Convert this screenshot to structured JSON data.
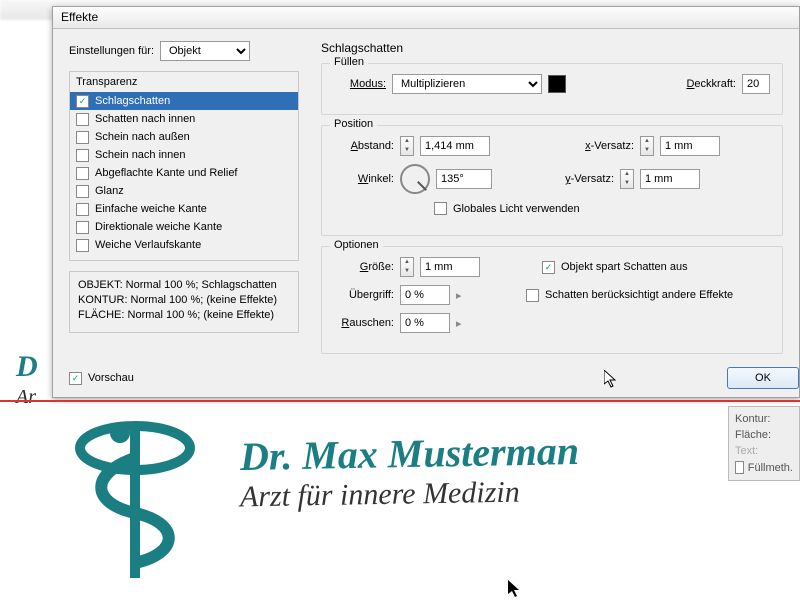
{
  "dialog": {
    "title": "Effekte",
    "settings_label": "Einstellungen für:",
    "settings_value": "Objekt",
    "transparency_group": "Transparenz",
    "effects": [
      {
        "label": "Schlagschatten",
        "checked": true,
        "selected": true
      },
      {
        "label": "Schatten nach innen",
        "checked": false
      },
      {
        "label": "Schein nach außen",
        "checked": false
      },
      {
        "label": "Schein nach innen",
        "checked": false
      },
      {
        "label": "Abgeflachte Kante und Relief",
        "checked": false
      },
      {
        "label": "Glanz",
        "checked": false
      },
      {
        "label": "Einfache weiche Kante",
        "checked": false
      },
      {
        "label": "Direktionale weiche Kante",
        "checked": false
      },
      {
        "label": "Weiche Verlaufskante",
        "checked": false
      }
    ],
    "status": {
      "l1": "OBJEKT: Normal 100 %; Schlagschatten",
      "l2": "KONTUR: Normal 100 %; (keine Effekte)",
      "l3": "FLÄCHE: Normal 100 %; (keine Effekte)"
    },
    "preview_label": "Vorschau",
    "ok_label": "OK"
  },
  "panel": {
    "title": "Schlagschatten",
    "fill": {
      "group": "Füllen",
      "mode_label": "Modus:",
      "mode_value": "Multiplizieren",
      "opacity_label": "Deckkraft:",
      "opacity_value": "20"
    },
    "position": {
      "group": "Position",
      "distance_label": "Abstand:",
      "distance_value": "1,414 mm",
      "angle_label": "Winkel:",
      "angle_value": "135°",
      "xoff_label": "x-Versatz:",
      "xoff_value": "1 mm",
      "yoff_label": "y-Versatz:",
      "yoff_value": "1 mm",
      "global_light": "Globales Licht verwenden"
    },
    "options": {
      "group": "Optionen",
      "size_label": "Größe:",
      "size_value": "1 mm",
      "spread_label": "Übergriff:",
      "spread_value": "0 %",
      "noise_label": "Rauschen:",
      "noise_value": "0 %",
      "knockout": "Objekt spart Schatten aus",
      "honors": "Schatten berücksichtigt andere Effekte"
    }
  },
  "artwork": {
    "headline": "Dr. Max Musterman",
    "subline": "Arzt für innere Medizin",
    "peek_h": "D",
    "peek_s": "Ar"
  },
  "sidepanel": {
    "kontur": "Kontur:",
    "flaeche": "Fläche:",
    "text": "Text:",
    "fuellmeth": "Füllmeth."
  },
  "colors": {
    "teal": "#1b7e82"
  }
}
